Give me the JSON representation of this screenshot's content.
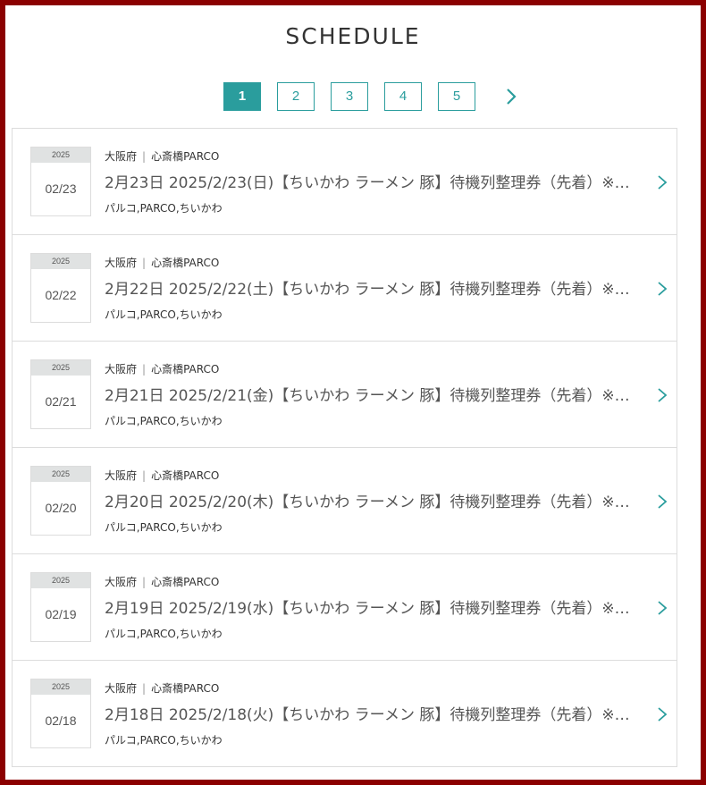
{
  "section_title": "SCHEDULE",
  "pagination": {
    "pages": [
      "1",
      "2",
      "3",
      "4",
      "5"
    ],
    "current": "1"
  },
  "accent_color": "#2a9d9d",
  "events": [
    {
      "year": "2025",
      "date": "02/23",
      "prefecture": "大阪府",
      "venue": "心斎橋PARCO",
      "title": "2月23日 2025/2/23(日)【ちいかわ ラーメン 豚】待機列整理券（先着）※…",
      "tags": "パルコ,PARCO,ちいかわ"
    },
    {
      "year": "2025",
      "date": "02/22",
      "prefecture": "大阪府",
      "venue": "心斎橋PARCO",
      "title": "2月22日 2025/2/22(土)【ちいかわ ラーメン 豚】待機列整理券（先着）※…",
      "tags": "パルコ,PARCO,ちいかわ"
    },
    {
      "year": "2025",
      "date": "02/21",
      "prefecture": "大阪府",
      "venue": "心斎橋PARCO",
      "title": "2月21日 2025/2/21(金)【ちいかわ ラーメン 豚】待機列整理券（先着）※…",
      "tags": "パルコ,PARCO,ちいかわ"
    },
    {
      "year": "2025",
      "date": "02/20",
      "prefecture": "大阪府",
      "venue": "心斎橋PARCO",
      "title": "2月20日 2025/2/20(木)【ちいかわ ラーメン 豚】待機列整理券（先着）※…",
      "tags": "パルコ,PARCO,ちいかわ"
    },
    {
      "year": "2025",
      "date": "02/19",
      "prefecture": "大阪府",
      "venue": "心斎橋PARCO",
      "title": "2月19日 2025/2/19(水)【ちいかわ ラーメン 豚】待機列整理券（先着）※…",
      "tags": "パルコ,PARCO,ちいかわ"
    },
    {
      "year": "2025",
      "date": "02/18",
      "prefecture": "大阪府",
      "venue": "心斎橋PARCO",
      "title": "2月18日 2025/2/18(火)【ちいかわ ラーメン 豚】待機列整理券（先着）※…",
      "tags": "パルコ,PARCO,ちいかわ"
    }
  ]
}
